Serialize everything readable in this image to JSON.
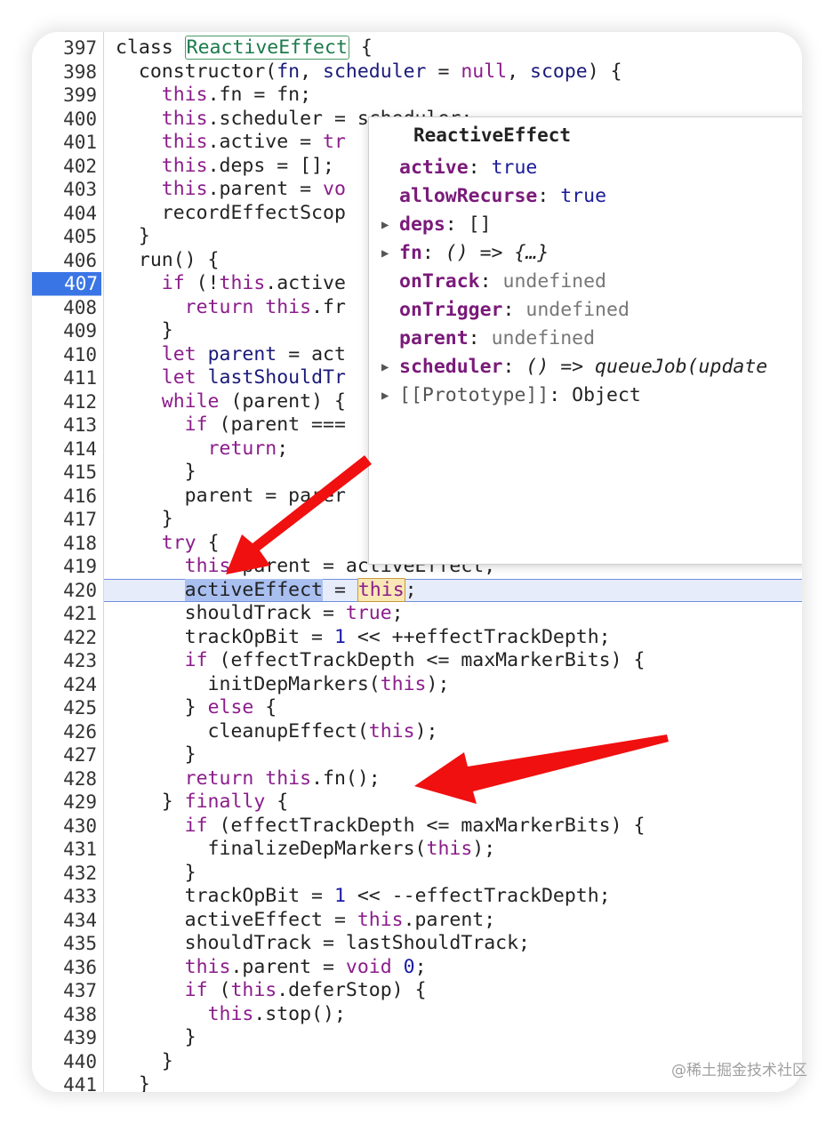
{
  "editor": {
    "breakpoint_line": "407",
    "execution_line": "420",
    "lines": [
      {
        "n": "397"
      },
      {
        "n": "398"
      },
      {
        "n": "399"
      },
      {
        "n": "400"
      },
      {
        "n": "401"
      },
      {
        "n": "402"
      },
      {
        "n": "403"
      },
      {
        "n": "404"
      },
      {
        "n": "405"
      },
      {
        "n": "406"
      },
      {
        "n": "407"
      },
      {
        "n": "408"
      },
      {
        "n": "409"
      },
      {
        "n": "410"
      },
      {
        "n": "411"
      },
      {
        "n": "412"
      },
      {
        "n": "413"
      },
      {
        "n": "414"
      },
      {
        "n": "415"
      },
      {
        "n": "416"
      },
      {
        "n": "417"
      },
      {
        "n": "418"
      },
      {
        "n": "419"
      },
      {
        "n": "420"
      },
      {
        "n": "421"
      },
      {
        "n": "422"
      },
      {
        "n": "423"
      },
      {
        "n": "424"
      },
      {
        "n": "425"
      },
      {
        "n": "426"
      },
      {
        "n": "427"
      },
      {
        "n": "428"
      },
      {
        "n": "429"
      },
      {
        "n": "430"
      },
      {
        "n": "431"
      },
      {
        "n": "432"
      },
      {
        "n": "433"
      },
      {
        "n": "434"
      },
      {
        "n": "435"
      },
      {
        "n": "436"
      },
      {
        "n": "437"
      },
      {
        "n": "438"
      },
      {
        "n": "439"
      },
      {
        "n": "440"
      },
      {
        "n": "441"
      }
    ],
    "code": {
      "l397": [
        "class ",
        "ReactiveEffect",
        " {"
      ],
      "l398": [
        "  constructor(",
        "fn",
        ", ",
        "scheduler",
        " = ",
        "null",
        ", ",
        "scope",
        ") {"
      ],
      "l399": [
        "    ",
        "this",
        ".fn = fn;"
      ],
      "l400": [
        "    ",
        "this",
        ".scheduler = scheduler;"
      ],
      "l401": [
        "    ",
        "this",
        ".active = ",
        "tr"
      ],
      "l402": [
        "    ",
        "this",
        ".deps = [];"
      ],
      "l403": [
        "    ",
        "this",
        ".parent = ",
        "vo"
      ],
      "l404": [
        "    recordEffectScop"
      ],
      "l405": [
        "  }"
      ],
      "l406": [
        "  run() {"
      ],
      "l407": [
        "    ",
        "if",
        " (!",
        "this",
        ".active"
      ],
      "l408": [
        "      ",
        "return",
        " ",
        "this",
        ".fr"
      ],
      "l409": [
        "    }"
      ],
      "l410": [
        "    ",
        "let",
        " ",
        "parent",
        " = act"
      ],
      "l411": [
        "    ",
        "let",
        " ",
        "lastShouldTr"
      ],
      "l412": [
        "    ",
        "while",
        " (parent) {"
      ],
      "l413": [
        "      ",
        "if",
        " (parent ==="
      ],
      "l414": [
        "        ",
        "return",
        ";"
      ],
      "l415": [
        "      }"
      ],
      "l416": [
        "      parent = parer"
      ],
      "l417": [
        "    }"
      ],
      "l418": [
        "    ",
        "try",
        " {"
      ],
      "l419": [
        "      ",
        "this",
        ".parent = activeEffect;"
      ],
      "l420": [
        "      ",
        "activeEffect",
        " = ",
        "this",
        ";"
      ],
      "l421": [
        "      shouldTrack = ",
        "true",
        ";"
      ],
      "l422": [
        "      trackOpBit = ",
        "1",
        " << ++effectTrackDepth;"
      ],
      "l423": [
        "      ",
        "if",
        " (effectTrackDepth <= maxMarkerBits) {"
      ],
      "l424": [
        "        initDepMarkers(",
        "this",
        ");"
      ],
      "l425": [
        "      } ",
        "else",
        " {"
      ],
      "l426": [
        "        cleanupEffect(",
        "this",
        ");"
      ],
      "l427": [
        "      }"
      ],
      "l428": [
        "      ",
        "return",
        " ",
        "this",
        ".fn();"
      ],
      "l429": [
        "    } ",
        "finally",
        " {"
      ],
      "l430": [
        "      ",
        "if",
        " (effectTrackDepth <= maxMarkerBits) {"
      ],
      "l431": [
        "        finalizeDepMarkers(",
        "this",
        ");"
      ],
      "l432": [
        "      }"
      ],
      "l433": [
        "      trackOpBit = ",
        "1",
        " << --effectTrackDepth;"
      ],
      "l434": [
        "      activeEffect = ",
        "this",
        ".parent;"
      ],
      "l435": [
        "      shouldTrack = lastShouldTrack;"
      ],
      "l436": [
        "      ",
        "this",
        ".parent = ",
        "void",
        " ",
        "0",
        ";"
      ],
      "l437": [
        "      ",
        "if",
        " (",
        "this",
        ".deferStop) {"
      ],
      "l438": [
        "        ",
        "this",
        ".stop();"
      ],
      "l439": [
        "      }"
      ],
      "l440": [
        "    }"
      ],
      "l441": [
        "  }"
      ]
    }
  },
  "popover": {
    "title": "ReactiveEffect",
    "properties": [
      {
        "expandable": false,
        "key": "active",
        "value": "true",
        "kind": "bool"
      },
      {
        "expandable": false,
        "key": "allowRecurse",
        "value": "true",
        "kind": "bool"
      },
      {
        "expandable": true,
        "key": "deps",
        "value": "[]",
        "kind": "plain"
      },
      {
        "expandable": true,
        "key": "fn",
        "value": "() => {…}",
        "kind": "fn"
      },
      {
        "expandable": false,
        "key": "onTrack",
        "value": "undefined",
        "kind": "undef"
      },
      {
        "expandable": false,
        "key": "onTrigger",
        "value": "undefined",
        "kind": "undef"
      },
      {
        "expandable": false,
        "key": "parent",
        "value": "undefined",
        "kind": "undef"
      },
      {
        "expandable": true,
        "key": "scheduler",
        "value": "() => queueJob(update",
        "kind": "fn"
      },
      {
        "expandable": true,
        "key": "[[Prototype]]",
        "value": "Object",
        "kind": "proto"
      }
    ]
  },
  "watermark": "@稀土掘金技术社区",
  "colors": {
    "breakpoint": "#3a75e6",
    "keyword": "#8b1d8b",
    "arrow": "#f01010"
  }
}
